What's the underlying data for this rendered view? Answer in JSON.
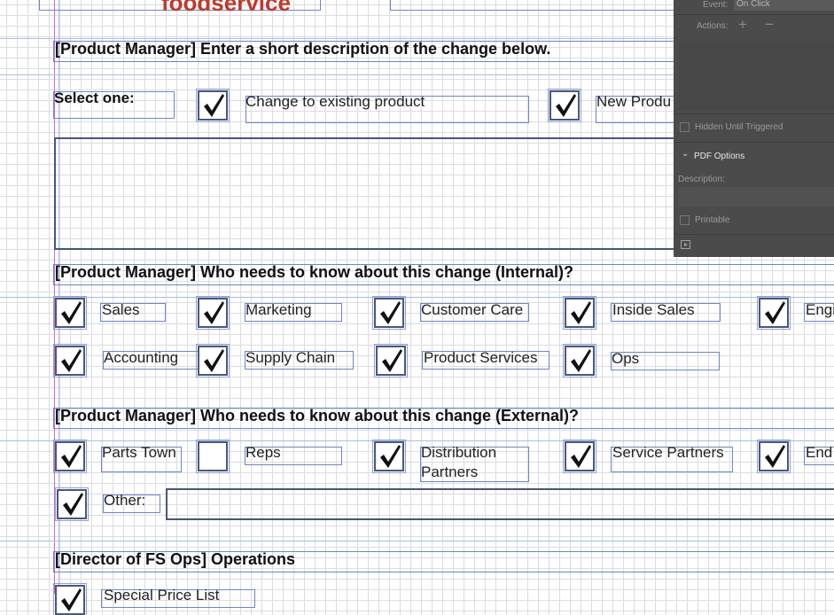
{
  "header": {
    "logo_text": "foodservice"
  },
  "section1": {
    "title": "[Product Manager]  Enter a short description of the change below.",
    "select_label": "Select one:",
    "options": [
      {
        "label": "Change to existing product",
        "checked": true
      },
      {
        "label": "New Produ",
        "checked": true
      }
    ]
  },
  "section2": {
    "title": "[Product Manager]  Who needs to know about this change (Internal)?",
    "row1": [
      {
        "label": "Sales",
        "checked": true
      },
      {
        "label": "Marketing",
        "checked": true
      },
      {
        "label": "Customer Care",
        "checked": true
      },
      {
        "label": "Inside Sales",
        "checked": true
      },
      {
        "label": "Engi",
        "checked": true
      }
    ],
    "row2": [
      {
        "label": "Accounting",
        "checked": true
      },
      {
        "label": "Supply Chain",
        "checked": true
      },
      {
        "label": "Product Services",
        "checked": true
      },
      {
        "label": "Ops",
        "checked": true
      }
    ]
  },
  "section3": {
    "title": "[Product Manager]  Who needs to know about this change (External)?",
    "row1": [
      {
        "label": "Parts Town",
        "checked": true
      },
      {
        "label": "Reps",
        "checked": false
      },
      {
        "label": "Distribution Partners",
        "checked": true
      },
      {
        "label": "Service Partners",
        "checked": true
      },
      {
        "label": "End",
        "checked": true
      }
    ],
    "other": {
      "label": "Other:",
      "checked": true
    }
  },
  "section4": {
    "title": "[Director of FS Ops]  Operations",
    "partial_label": "Special Price List"
  },
  "panel": {
    "event_label": "Event:",
    "event_value": "On Click",
    "actions_label": "Actions:",
    "add_symbol": "+",
    "remove_symbol": "−",
    "hidden_label": "Hidden Until Triggered",
    "pdf_options_label": "PDF Options",
    "description_label": "Description:",
    "printable_label": "Printable"
  },
  "colors": {
    "accent_red": "#c0392b",
    "frame_blue": "#6f86c6",
    "panel_bg": "#4b4b4b"
  }
}
